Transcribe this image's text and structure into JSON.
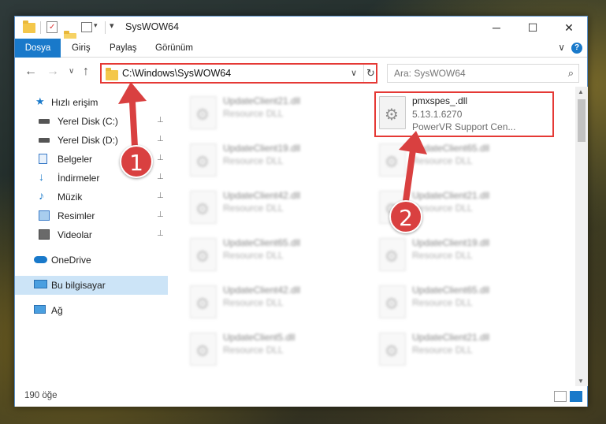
{
  "window": {
    "title": "SysWOW64",
    "minimize": "─",
    "maximize": "☐",
    "close": "✕"
  },
  "ribbon": {
    "tabs": [
      "Dosya",
      "Giriş",
      "Paylaş",
      "Görünüm"
    ],
    "collapse": "∨",
    "help": "?"
  },
  "nav": {
    "back": "←",
    "forward": "→",
    "recent": "∨",
    "up": "↑",
    "address": "C:\\Windows\\SysWOW64",
    "address_dropdown": "∨",
    "refresh": "↻",
    "search_placeholder": "Ara: SysWOW64",
    "search_icon": "⌕"
  },
  "sidebar": {
    "items": [
      {
        "label": "Hızlı erişim",
        "icon": "star-icon",
        "pinned": false
      },
      {
        "label": "Yerel Disk (C:)",
        "icon": "drive-icon",
        "pinned": true
      },
      {
        "label": "Yerel Disk (D:)",
        "icon": "drive-icon",
        "pinned": true
      },
      {
        "label": "Belgeler",
        "icon": "documents-icon",
        "pinned": true
      },
      {
        "label": "İndirmeler",
        "icon": "downloads-icon",
        "pinned": true
      },
      {
        "label": "Müzik",
        "icon": "music-icon",
        "pinned": true
      },
      {
        "label": "Resimler",
        "icon": "pictures-icon",
        "pinned": true
      },
      {
        "label": "Videolar",
        "icon": "videos-icon",
        "pinned": true
      },
      {
        "label": "OneDrive",
        "icon": "cloud-icon",
        "pinned": false
      },
      {
        "label": "Bu bilgisayar",
        "icon": "computer-icon",
        "pinned": false
      },
      {
        "label": "Ağ",
        "icon": "network-icon",
        "pinned": false
      }
    ],
    "pin_glyph": "📌"
  },
  "files": {
    "left": [
      {
        "name": "UpdateClient21.dll",
        "type": "Resource DLL"
      },
      {
        "name": "UpdateClient19.dll",
        "type": "Resource DLL"
      },
      {
        "name": "UpdateClient42.dll",
        "type": "Resource DLL"
      },
      {
        "name": "UpdateClient65.dll",
        "type": "Resource DLL"
      },
      {
        "name": "UpdateClient42.dll",
        "type": "Resource DLL"
      },
      {
        "name": "UpdateClient5.dll",
        "type": "Resource DLL"
      }
    ],
    "right": [
      {
        "name": "UpdateClient65.dll",
        "type": "Resource DLL"
      },
      {
        "name": "UpdateClient21.dll",
        "type": "Resource DLL"
      },
      {
        "name": "UpdateClient19.dll",
        "type": "Resource DLL"
      },
      {
        "name": "UpdateClient65.dll",
        "type": "Resource DLL"
      },
      {
        "name": "UpdateClient21.dll",
        "type": "Resource DLL"
      }
    ],
    "featured": {
      "name": "pmxspes_.dll",
      "version": "5.13.1.6270",
      "description": "PowerVR Support Cen..."
    }
  },
  "status": {
    "count": "190 öğe"
  },
  "annotations": {
    "badge1": "1",
    "badge2": "2",
    "color": "#e53935"
  }
}
